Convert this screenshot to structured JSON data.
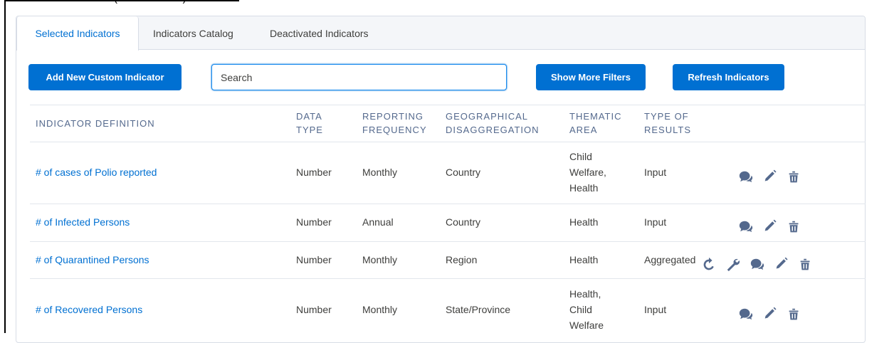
{
  "caption": "(— — — — —)",
  "tabs": [
    "Selected Indicators",
    "Indicators Catalog",
    "Deactivated Indicators"
  ],
  "toolbar": {
    "add_label": "Add New Custom Indicator",
    "search_placeholder": "Search",
    "filters_label": "Show More Filters",
    "refresh_label": "Refresh Indicators"
  },
  "table": {
    "headers": {
      "definition": "INDICATOR DEFINITION",
      "data_type": "DATA TYPE",
      "frequency": "REPORTING FREQUENCY",
      "geo": "GEOGRAPHICAL DISAGGREGATION",
      "thematic": "THEMATIC AREA",
      "results": "TYPE OF RESULTS"
    },
    "rows": [
      {
        "definition": "# of cases of Polio reported",
        "data_type": "Number",
        "frequency": "Monthly",
        "geo": "Country",
        "thematic": "Child Welfare, Health",
        "results": "Input",
        "actions": [
          "chat-icon",
          "edit-icon",
          "delete-icon"
        ]
      },
      {
        "definition": "# of Infected Persons",
        "data_type": "Number",
        "frequency": "Annual",
        "geo": "Country",
        "thematic": "Health",
        "results": "Input",
        "actions": [
          "chat-icon",
          "edit-icon",
          "delete-icon"
        ]
      },
      {
        "definition": "# of Quarantined Persons",
        "data_type": "Number",
        "frequency": "Monthly",
        "geo": "Region",
        "thematic": "Health",
        "results": "Aggregated",
        "actions": [
          "refresh-icon",
          "wrench-icon",
          "chat-icon",
          "edit-icon",
          "delete-icon"
        ]
      },
      {
        "definition": "# of Recovered Persons",
        "data_type": "Number",
        "frequency": "Monthly",
        "geo": "State/Province",
        "thematic": "Health, Child Welfare",
        "results": "Input",
        "actions": [
          "chat-icon",
          "edit-icon",
          "delete-icon"
        ]
      }
    ]
  },
  "colors": {
    "accent": "#0070d2",
    "icon": "#54698d",
    "header_text": "#54698d"
  }
}
